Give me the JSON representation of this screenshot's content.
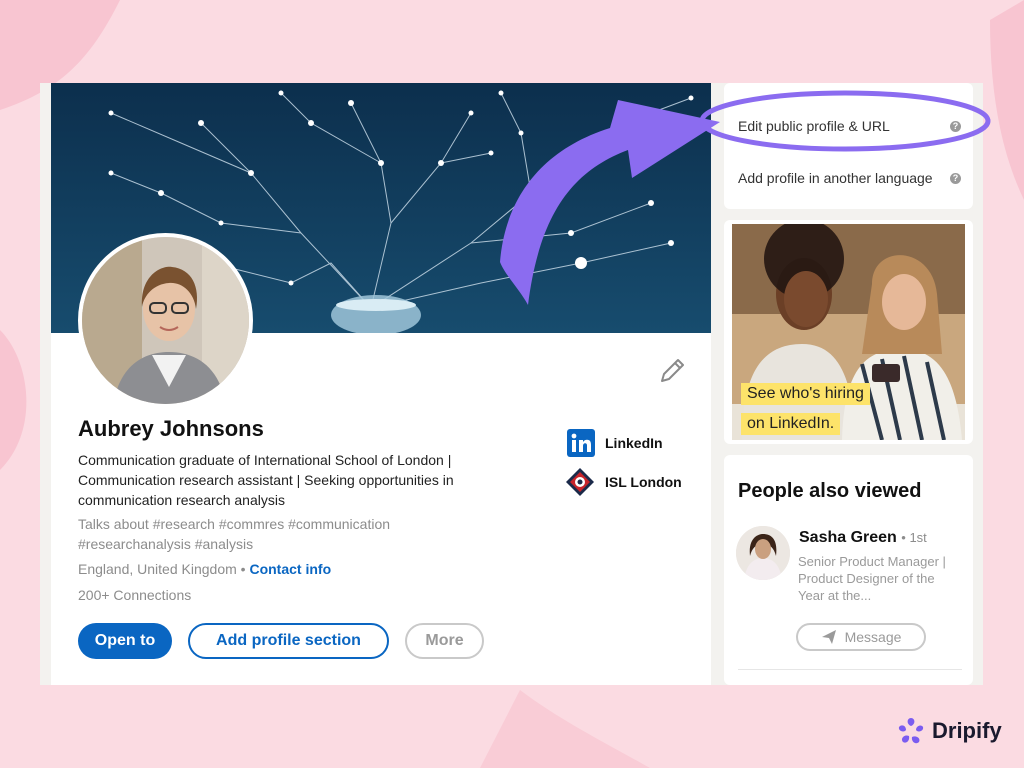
{
  "profile": {
    "name": "Aubrey Johnsons",
    "headline": "Communication graduate of International School of London | Communication research assistant | Seeking opportunities in communication research analysis",
    "hashtags": "Talks about #research #commres #communication #researchanalysis #analysis",
    "location": "England, United Kingdom",
    "separator": "•",
    "contact_label": "Contact info",
    "connections": "200+ Connections",
    "buttons": {
      "open_to": "Open to",
      "add_section": "Add profile section",
      "more": "More"
    },
    "companies": [
      {
        "name": "LinkedIn",
        "icon": "linkedin-logo"
      },
      {
        "name": "ISL London",
        "icon": "isl-london-logo"
      }
    ]
  },
  "sidebar": {
    "links": [
      {
        "label": "Edit public profile & URL",
        "help": "?"
      },
      {
        "label": "Add profile in another language",
        "help": "?"
      }
    ],
    "ad": {
      "line1": "See who's hiring",
      "line2": "on LinkedIn."
    },
    "people_also_viewed": {
      "title": "People also viewed",
      "person": {
        "name": "Sasha Green",
        "degree": "• 1st",
        "title": "Senior Product Manager | Product Designer of the Year at the...",
        "message_label": "Message"
      }
    }
  },
  "brand": {
    "name": "Dripify"
  },
  "colors": {
    "linkedin_blue": "#0a66c2",
    "highlight_purple": "#8b6cf0",
    "background_pink": "#fbdbe2",
    "ad_yellow": "#fde36a"
  }
}
